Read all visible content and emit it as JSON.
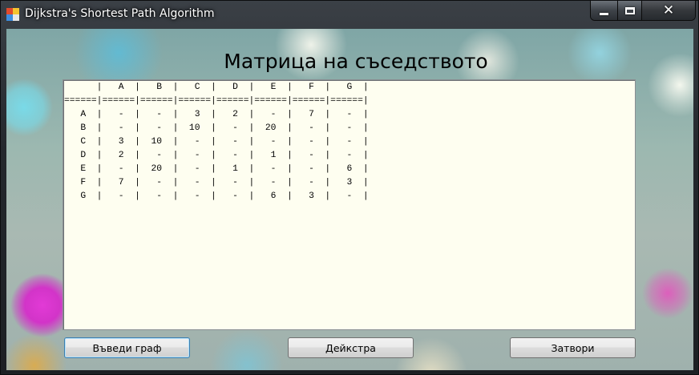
{
  "window": {
    "title": "Dijkstra's Shortest Path Algorithm",
    "icon": "app-icon",
    "controls": {
      "minimize_icon": "minimize-icon",
      "maximize_icon": "maximize-icon",
      "close_icon": "close-icon",
      "close_glyph": "✕"
    }
  },
  "main": {
    "heading": "Матрица на съседството",
    "matrix": {
      "header": "      |   A  |   B  |   C  |   D  |   E  |   F  |   G  |",
      "separator": "======|======|======|======|======|======|======|======|",
      "rows": [
        "   A  |   -  |   -  |   3  |   2  |   -  |   7  |   -  |",
        "   B  |   -  |   -  |  10  |   -  |  20  |   -  |   -  |",
        "   C  |   3  |  10  |   -  |   -  |   -  |   -  |   -  |",
        "   D  |   2  |   -  |   -  |   -  |   1  |   -  |   -  |",
        "   E  |   -  |  20  |   -  |   1  |   -  |   -  |   6  |",
        "   F  |   7  |   -  |   -  |   -  |   -  |   -  |   3  |",
        "   G  |   -  |   -  |   -  |   -  |   6  |   3  |   -  |"
      ]
    }
  },
  "buttons": {
    "enter_graph": "Въведи граф",
    "dijkstra": "Дейкстра",
    "close": "Затвори"
  }
}
